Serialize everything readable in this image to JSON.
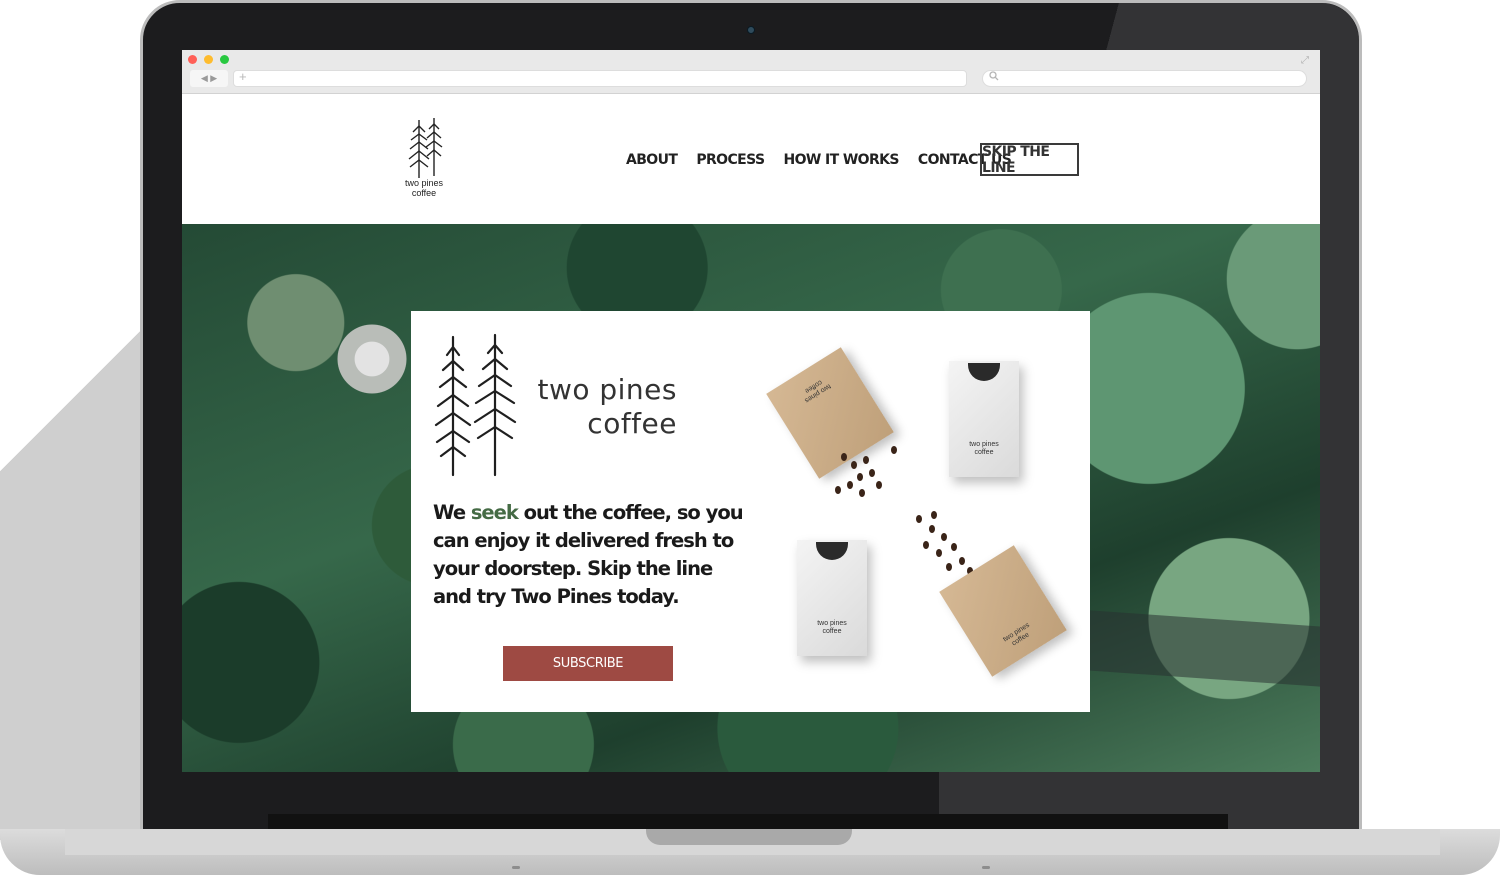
{
  "browser": {
    "nav_arrows": "◀ ▶",
    "plus_icon": "+",
    "expand_icon": "⤢",
    "address_value": "",
    "search_value": ""
  },
  "site": {
    "logo_text_line1": "two pines",
    "logo_text_line2": "coffee",
    "nav_items": [
      "ABOUT",
      "PROCESS",
      "HOW IT WORKS",
      "CONTACT US"
    ],
    "cta_label": "SKIP THE LINE"
  },
  "hero": {
    "brand_line1": "two pines",
    "brand_line2": "coffee",
    "tagline_before": "We ",
    "tagline_highlight": "seek",
    "tagline_after": " out the coffee, so you can enjoy it delivered fresh to your doorstep. Skip the line and try Two Pines today.",
    "subscribe_label": "SUBSCRIBE",
    "bag_label_line1": "two pines",
    "bag_label_line2": "coffee",
    "bag_top_label_line1": "two pines",
    "bag_top_label_line2": "coffee"
  },
  "colors": {
    "highlight": "#456b45",
    "subscribe_button": "#9e4a43",
    "text": "#1a1a1a"
  },
  "icons": [
    "pine-trees-logo-icon",
    "search-icon",
    "plus-icon",
    "expand-icon",
    "back-arrow-icon",
    "forward-arrow-icon"
  ]
}
